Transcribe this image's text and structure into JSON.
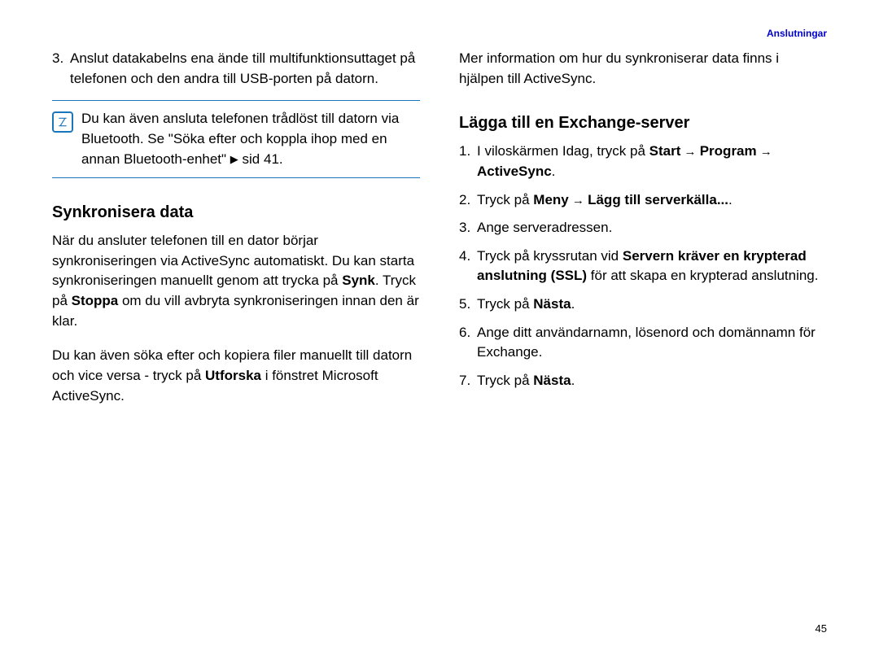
{
  "header": {
    "section": "Anslutningar"
  },
  "left": {
    "step3_num": "3.",
    "step3_text": "Anslut datakabelns ena ände till multifunktionsuttaget på telefonen och den andra till USB-porten på datorn.",
    "note_pre": "Du kan även ansluta telefonen trådlöst till datorn via Bluetooth. Se \"Söka efter och koppla ihop med en annan Bluetooth-enhet\" ",
    "note_page": "sid 41.",
    "h_sync": "Synkronisera data",
    "sync_p1_a": "När du ansluter telefonen till en dator börjar synkroniseringen via ActiveSync automatiskt. Du kan starta synkroniseringen manuellt genom att trycka på ",
    "sync_p1_b": "Synk",
    "sync_p1_c": ". Tryck på ",
    "sync_p1_d": "Stoppa",
    "sync_p1_e": " om du vill avbryta synkroniseringen innan den är klar.",
    "sync_p2_a": "Du kan även söka efter och kopiera filer manuellt till datorn och vice versa - tryck på ",
    "sync_p2_b": "Utforska",
    "sync_p2_c": " i fönstret Microsoft ActiveSync."
  },
  "right": {
    "intro": "Mer information om hur du synkroniserar data finns i hjälpen till ActiveSync.",
    "h_exchange": "Lägga till en Exchange-server",
    "s1_num": "1.",
    "s1_a": "I viloskärmen Idag, tryck på ",
    "s1_b": "Start",
    "s1_arrow1": " → ",
    "s1_c": "Program",
    "s1_arrow2": " → ",
    "s1_d": "ActiveSync",
    "s1_e": ".",
    "s2_num": "2.",
    "s2_a": "Tryck på ",
    "s2_b": "Meny",
    "s2_arrow": " → ",
    "s2_c": "Lägg till serverkälla...",
    "s2_d": ".",
    "s3_num": "3.",
    "s3": "Ange serveradressen.",
    "s4_num": "4.",
    "s4_a": "Tryck på kryssrutan vid ",
    "s4_b": "Servern kräver en krypterad anslutning (SSL)",
    "s4_c": " för att skapa en krypterad anslutning.",
    "s5_num": "5.",
    "s5_a": "Tryck på ",
    "s5_b": "Nästa",
    "s5_c": ".",
    "s6_num": "6.",
    "s6": "Ange ditt användarnamn, lösenord och domännamn för Exchange.",
    "s7_num": "7.",
    "s7_a": "Tryck på ",
    "s7_b": "Nästa",
    "s7_c": "."
  },
  "page_number": "45"
}
